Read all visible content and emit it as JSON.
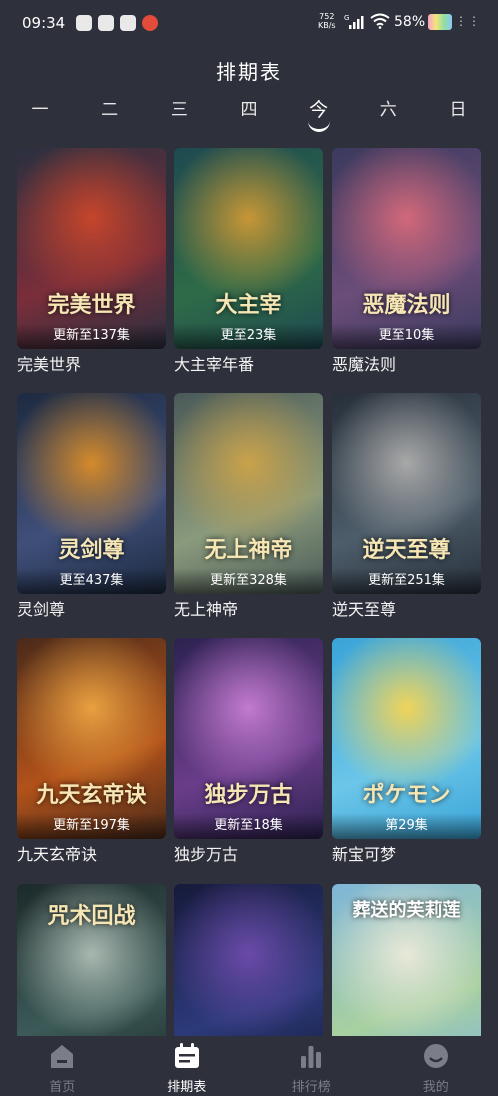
{
  "status_bar": {
    "time": "09:34",
    "net_speed_value": "752",
    "net_speed_unit": "KB/s",
    "battery": "58%",
    "apps": [
      "app-icon-1",
      "app-icon-2",
      "mail-icon",
      "weibo-icon"
    ]
  },
  "header": {
    "title": "排期表"
  },
  "days": [
    {
      "label": "一"
    },
    {
      "label": "二"
    },
    {
      "label": "三"
    },
    {
      "label": "四"
    },
    {
      "label": "今",
      "active": true
    },
    {
      "label": "六"
    },
    {
      "label": "日"
    }
  ],
  "shows": [
    {
      "name": "完美世界",
      "episode": "更新至137集",
      "logo": "完美世界",
      "colors": [
        "#2a3040",
        "#7a2e3a",
        "#c6452b"
      ]
    },
    {
      "name": "大主宰年番",
      "episode": "更至23集",
      "logo": "大主宰",
      "colors": [
        "#1e4a50",
        "#2f6b48",
        "#c79636"
      ]
    },
    {
      "name": "恶魔法则",
      "episode": "更至10集",
      "logo": "恶魔法则",
      "colors": [
        "#3b3a5e",
        "#6b4d79",
        "#d2687a"
      ]
    },
    {
      "name": "灵剑尊",
      "episode": "更至437集",
      "logo": "灵剑尊",
      "colors": [
        "#1d2a40",
        "#3f4f7a",
        "#d48a2a"
      ]
    },
    {
      "name": "无上神帝",
      "episode": "更新至328集",
      "logo": "无上神帝",
      "colors": [
        "#4a5a58",
        "#8a9a7c",
        "#c9a24a"
      ]
    },
    {
      "name": "逆天至尊",
      "episode": "更新至251集",
      "logo": "逆天至尊",
      "colors": [
        "#27303a",
        "#4d5d6a",
        "#a8a8a8"
      ]
    },
    {
      "name": "九天玄帝诀",
      "episode": "更新至197集",
      "logo": "九天玄帝诀",
      "colors": [
        "#4a2a1a",
        "#b2521a",
        "#e8a040"
      ]
    },
    {
      "name": "独步万古",
      "episode": "更新至18集",
      "logo": "独步万古",
      "colors": [
        "#2d2250",
        "#6a3d8a",
        "#c27ad0"
      ]
    },
    {
      "name": "新宝可梦",
      "episode": "第29集",
      "logo": "ポケモン",
      "colors": [
        "#3aa4d8",
        "#6bc6e8",
        "#f0d45a"
      ]
    },
    {
      "name": "",
      "episode": "",
      "logo": "咒术回战",
      "colors": [
        "#1c2a2a",
        "#3c5a58",
        "#a8b8b0"
      ]
    },
    {
      "name": "",
      "episode": "",
      "logo": "",
      "colors": [
        "#161a3a",
        "#2c3a7a",
        "#6a4aa8"
      ]
    },
    {
      "name": "",
      "episode": "",
      "logo": "葬送的芙莉莲",
      "colors": [
        "#7fb6d8",
        "#a8d0a0",
        "#e8e8d8"
      ]
    }
  ],
  "nav": [
    {
      "label": "首页",
      "icon": "home-icon"
    },
    {
      "label": "排期表",
      "icon": "calendar-icon",
      "active": true
    },
    {
      "label": "排行榜",
      "icon": "ranking-icon"
    },
    {
      "label": "我的",
      "icon": "profile-icon"
    }
  ]
}
